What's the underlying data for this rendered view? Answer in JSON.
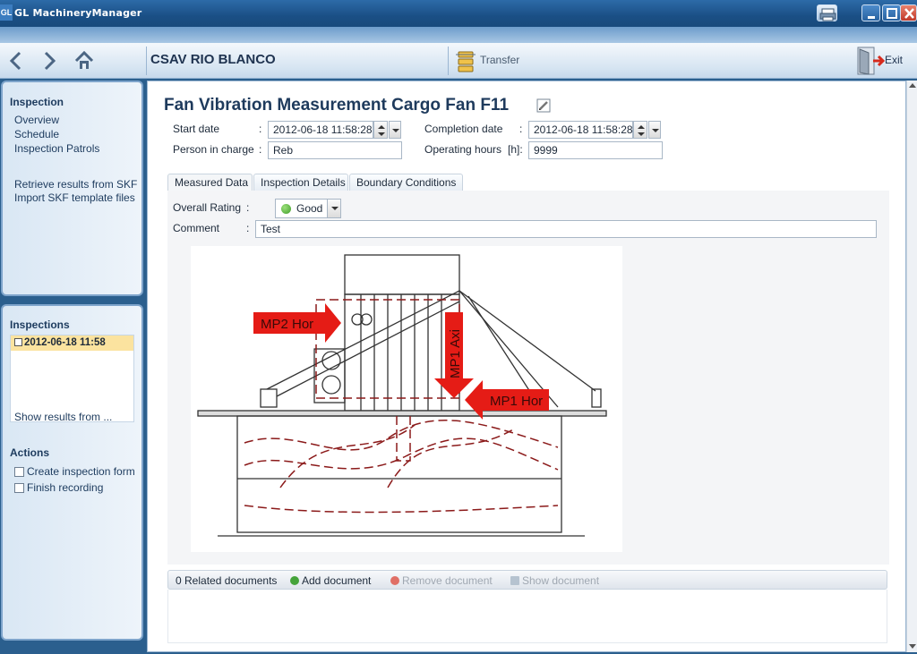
{
  "window": {
    "logo_text": "GL",
    "title": "GL MachineryManager"
  },
  "toolbar": {
    "vessel": "CSAV RIO BLANCO",
    "transfer_label": "Transfer",
    "exit_label": "Exit"
  },
  "sidebar": {
    "inspection_heading": "Inspection",
    "inspection_links": [
      "Overview",
      "Schedule",
      "Inspection Patrols"
    ],
    "skf_links": [
      "Retrieve results from SKF",
      "Import SKF template files"
    ],
    "inspections_heading": "Inspections",
    "inspections_items": [
      "2012-06-18 11:58"
    ],
    "show_results": "Show results from ...",
    "actions_heading": "Actions",
    "actions": [
      "Create inspection form",
      "Finish recording"
    ]
  },
  "main": {
    "title": "Fan Vibration Measurement Cargo Fan F11",
    "start_date_label": "Start date",
    "start_date": "2012-06-18 11:58:28",
    "completion_date_label": "Completion date",
    "completion_date": "2012-06-18 11:58:28",
    "person_label": "Person in charge",
    "person": "Reb",
    "hours_label": "Operating hours",
    "hours_unit": "[h]:",
    "hours": "9999",
    "colon": ":",
    "tabs": [
      "Measured Data",
      "Inspection Details",
      "Boundary Conditions"
    ],
    "rating_label": "Overall Rating",
    "rating": "Good",
    "comment_label": "Comment",
    "comment": "Test",
    "drawing_labels": {
      "mp2": "MP2 Hor",
      "mp1_axi": "MP1 Axi",
      "mp1_hor": "MP1 Hor"
    }
  },
  "documents": {
    "count_label": "0 Related documents",
    "add": "Add document",
    "remove": "Remove document",
    "show": "Show document"
  },
  "colors": {
    "accent": "#2b5f8e",
    "title_text": "#1e3a5c",
    "arrow_red": "#e51c16",
    "selected_item": "#fbe39f",
    "rating_good": "#3f9d2a"
  }
}
